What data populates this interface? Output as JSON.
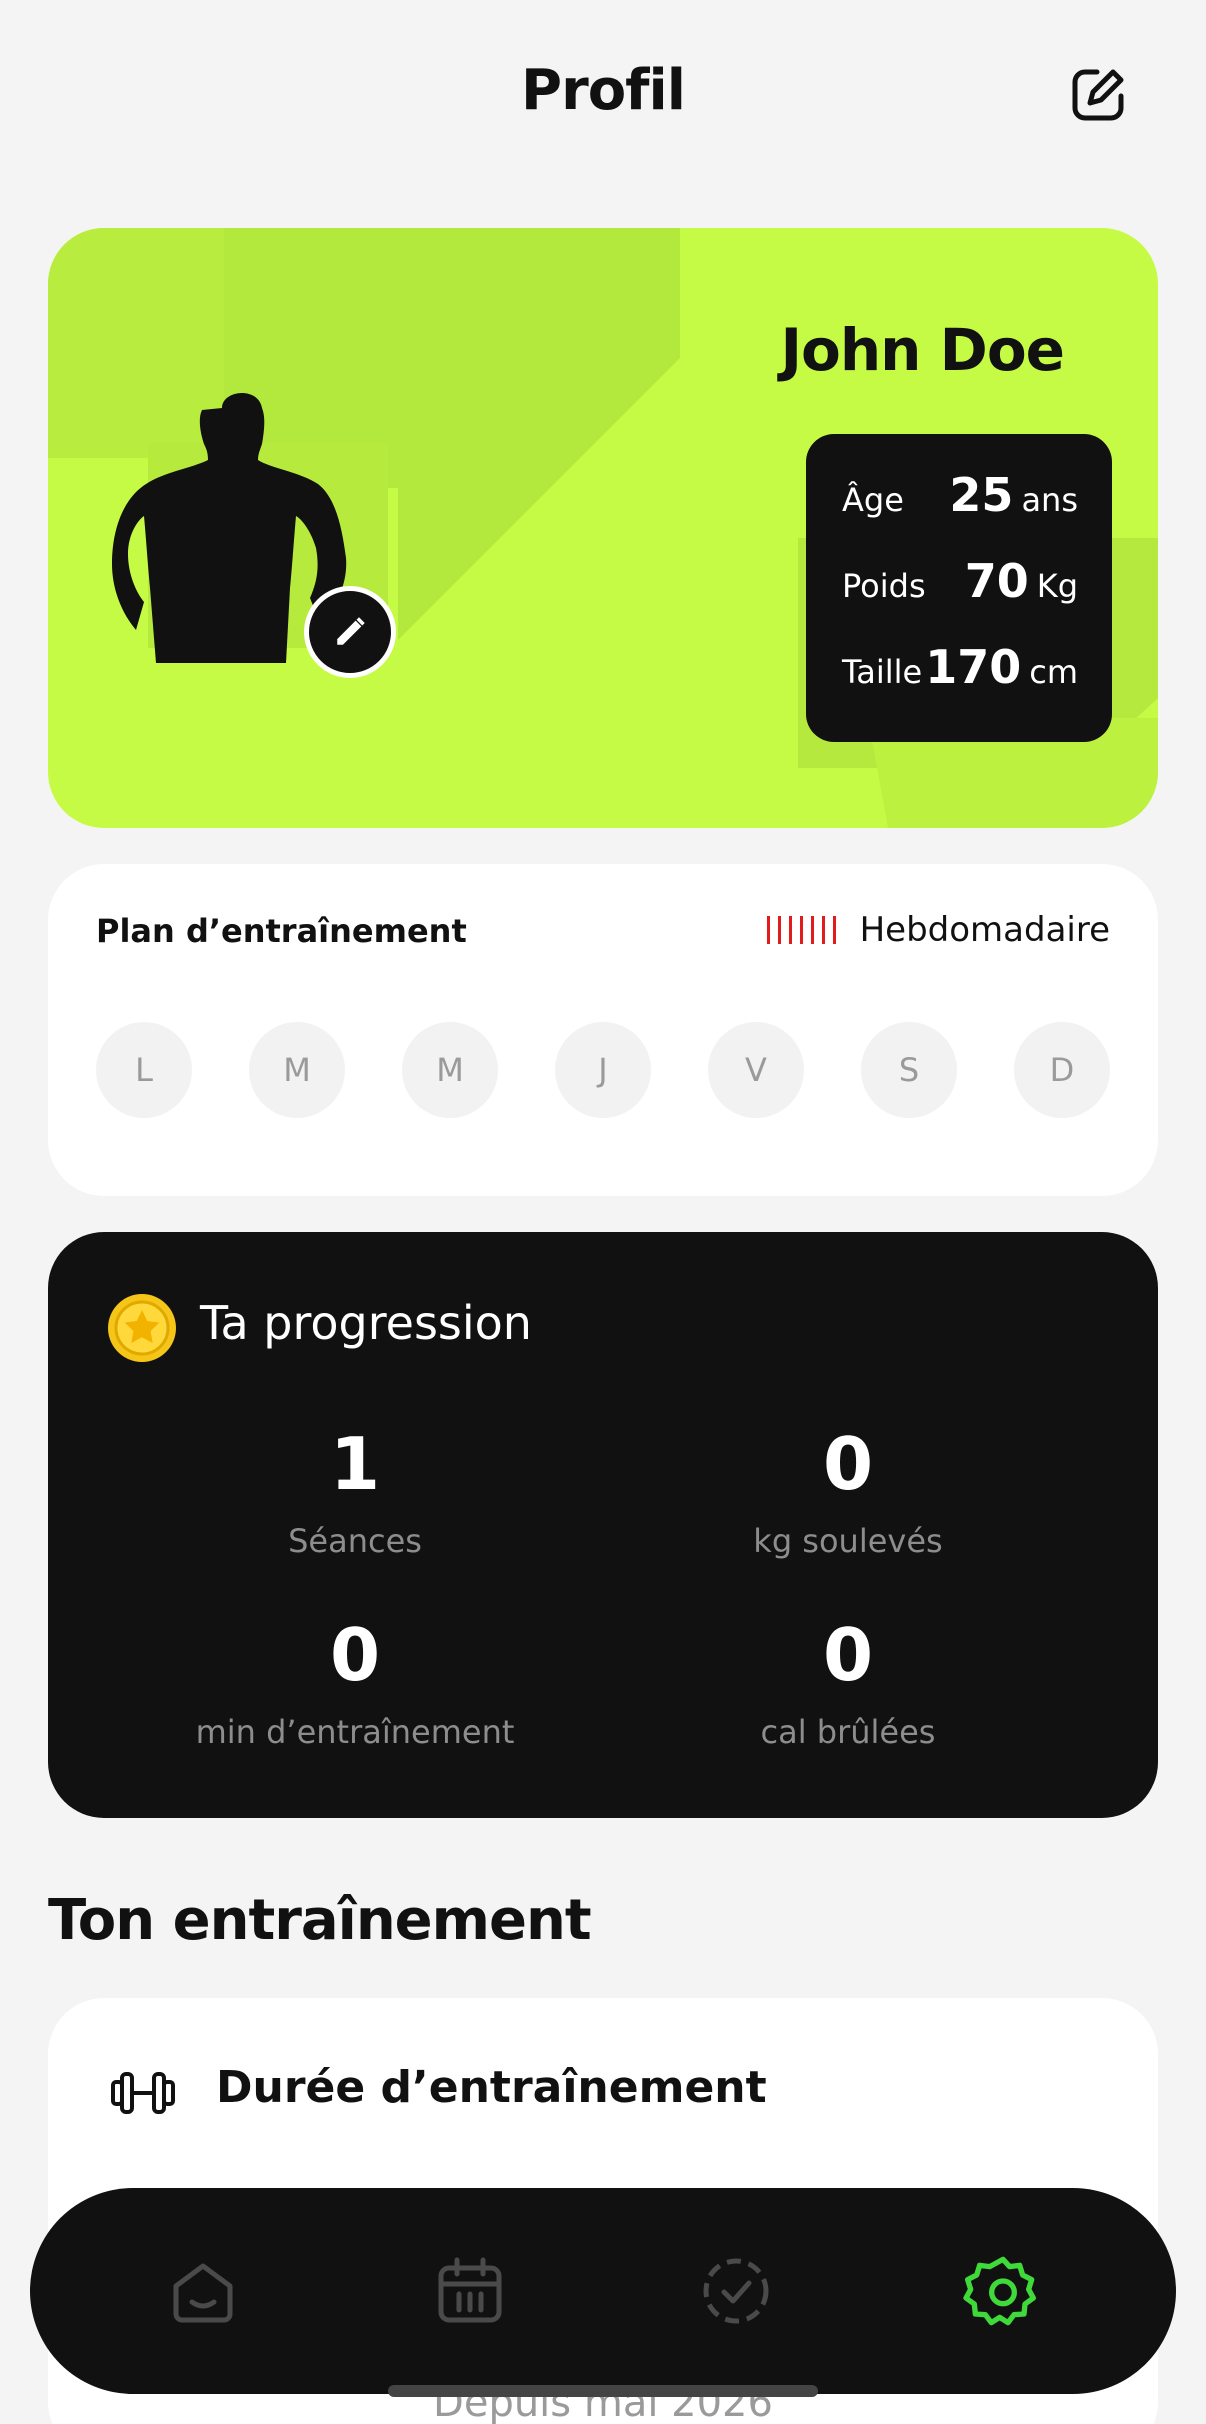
{
  "header": {
    "title": "Profil"
  },
  "profile": {
    "name": "John Doe",
    "stats": [
      {
        "label": "Âge",
        "value": "25",
        "unit": "ans"
      },
      {
        "label": "Poids",
        "value": "70",
        "unit": "Kg"
      },
      {
        "label": "Taille",
        "value": "170",
        "unit": "cm"
      }
    ]
  },
  "plan": {
    "title": "Plan d’entraînement",
    "frequency": "Hebdomadaire",
    "days": [
      "L",
      "M",
      "M",
      "J",
      "V",
      "S",
      "D"
    ]
  },
  "progress": {
    "title": "Ta progression",
    "metrics": [
      {
        "value": "1",
        "label": "Séances"
      },
      {
        "value": "0",
        "label": "kg soulevés"
      },
      {
        "value": "0",
        "label": "min d’entraînement"
      },
      {
        "value": "0",
        "label": "cal brûlées"
      }
    ]
  },
  "training": {
    "section_title": "Ton entraînement",
    "card_title": "Durée d’entraînement",
    "since": "Depuis mai 2026"
  },
  "nav": {
    "items": [
      "home-icon",
      "calendar-icon",
      "progress-check-icon",
      "settings-icon"
    ],
    "active_color": "#3fd93a",
    "inactive_color": "#4a4a4a"
  },
  "colors": {
    "accent": "#c6fb45",
    "dark": "#111111"
  }
}
